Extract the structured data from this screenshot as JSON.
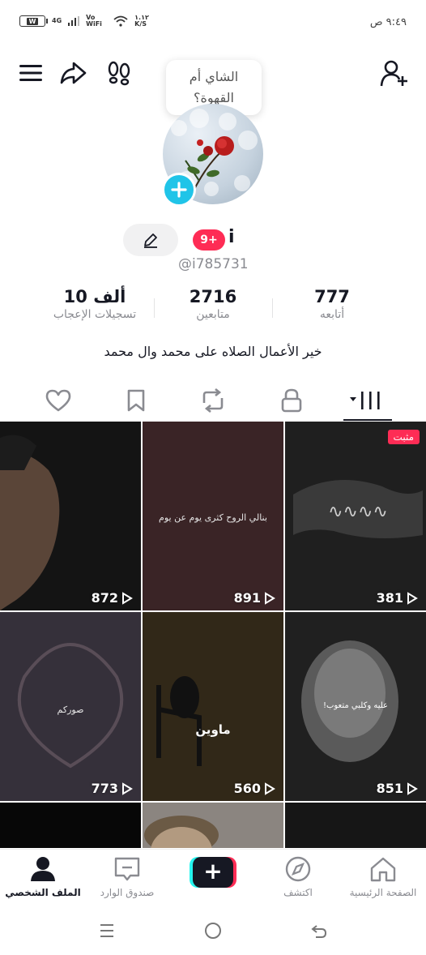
{
  "status_bar": {
    "time": "٩:٤٩ ص",
    "battery_level": "W",
    "network": "4G",
    "volte": "Vo WiFi",
    "speed": "١.١٢ K/S"
  },
  "tooltip": {
    "line1": "الشاي أم",
    "line2": "القهوة؟"
  },
  "profile": {
    "notification_badge": "9+",
    "display_name": "i",
    "handle": "@i785731",
    "bio": "خير الأعمال الصلاه على محمد وال محمد"
  },
  "stats": [
    {
      "value": "777",
      "label": "أتابعه"
    },
    {
      "value": "2716",
      "label": "متابعين"
    },
    {
      "value": "10 ألف",
      "label": "تسجيلات الإعجاب"
    }
  ],
  "tabs": [
    {
      "name": "videos",
      "icon": "grid-icon"
    },
    {
      "name": "private",
      "icon": "lock-icon"
    },
    {
      "name": "reposts",
      "icon": "repost-icon"
    },
    {
      "name": "favorites",
      "icon": "bookmark-icon"
    },
    {
      "name": "liked",
      "icon": "heart-icon"
    }
  ],
  "videos": [
    {
      "views": "381",
      "pinned_label": "مثبت",
      "caption": "",
      "bg": "#1f1f1f"
    },
    {
      "views": "891",
      "caption": "بنالي الروح كثرى يوم عن يوم",
      "bg": "#3a2426"
    },
    {
      "views": "872",
      "caption": "",
      "bg": "#141414"
    },
    {
      "views": "851",
      "caption": "عليه وكلبي متعوب!",
      "bg": "#202020"
    },
    {
      "views": "560",
      "caption": "ماوين",
      "bg": "#2c2416"
    },
    {
      "views": "773",
      "caption": "صوركم",
      "bg": "#35303a"
    },
    {
      "views": "",
      "caption": "",
      "bg": "#161616"
    },
    {
      "views": "",
      "caption": "",
      "bg": "#8b8580"
    },
    {
      "views": "",
      "caption": "",
      "bg": "#070707"
    }
  ],
  "bottom_nav": {
    "home": "الصفحة الرئيسية",
    "discover": "اكتشف",
    "inbox": "صندوق الوارد",
    "profile": "الملف الشخصي"
  },
  "colors": {
    "accent": "#fe2c55",
    "cyan": "#25f4ee",
    "add_avatar": "#20c4e8"
  }
}
